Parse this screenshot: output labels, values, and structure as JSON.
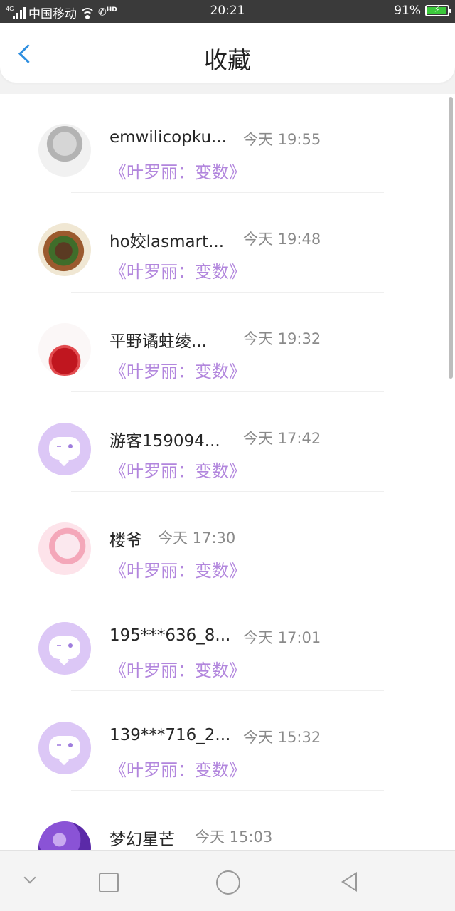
{
  "status_bar": {
    "network_tag": "4G",
    "carrier": "中国移动",
    "hd": "HD",
    "time": "20:21",
    "battery": "91%",
    "battery_level": 0.91
  },
  "header": {
    "title": "收藏"
  },
  "items": [
    {
      "avatar": "sketch-portrait",
      "name": "emwilicopku...",
      "time": "今天 19:55",
      "subtitle": "《叶罗丽：变数》"
    },
    {
      "avatar": "food-photo",
      "name": "ho姣lasmart...",
      "time": "今天 19:48",
      "subtitle": "《叶罗丽：变数》"
    },
    {
      "avatar": "flower-doll",
      "name": "平野谲蛀绫...",
      "time": "今天 19:32",
      "subtitle": "《叶罗丽：变数》"
    },
    {
      "avatar": "default-chat-icon",
      "name": "游客159094...",
      "time": "今天 17:42",
      "subtitle": "《叶罗丽：变数》"
    },
    {
      "avatar": "anime-girl",
      "name": "楼爷",
      "time": "今天 17:30",
      "subtitle": "《叶罗丽：变数》"
    },
    {
      "avatar": "default-chat-icon",
      "name": "195***636_8...",
      "time": "今天 17:01",
      "subtitle": "《叶罗丽：变数》"
    },
    {
      "avatar": "default-chat-icon",
      "name": "139***716_2...",
      "time": "今天 15:32",
      "subtitle": "《叶罗丽：变数》"
    },
    {
      "avatar": "space-galaxy",
      "name": "梦幻星芒",
      "time": "今天 15:03",
      "subtitle": ""
    }
  ],
  "colors": {
    "accent": "#2d8ee0",
    "subtitle": "#b286dd",
    "default_avatar": "#dcc7f6"
  },
  "nav_bar": [
    "collapse-icon",
    "recent-apps-icon",
    "home-icon",
    "back-icon"
  ]
}
